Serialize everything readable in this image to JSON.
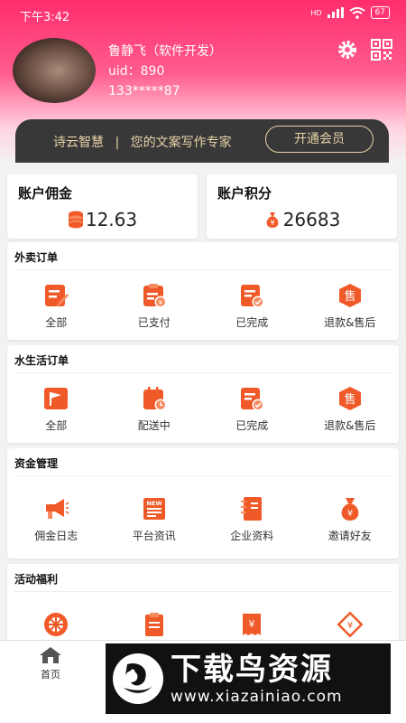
{
  "status": {
    "time": "下午3:42",
    "battery": "67",
    "net": "HD"
  },
  "user": {
    "name": "鲁静飞（软件开发）",
    "uid": "uid：890",
    "phone": "133*****87"
  },
  "member": {
    "brand": "诗云智慧",
    "divider": "|",
    "tagline": "您的文案写作专家",
    "button": "开通会员"
  },
  "accounts": [
    {
      "title": "账户佣金",
      "value": "12.63"
    },
    {
      "title": "账户积分",
      "value": "26683"
    }
  ],
  "sections": [
    {
      "title": "外卖订单",
      "items": [
        "全部",
        "已支付",
        "已完成",
        "退款&售后"
      ]
    },
    {
      "title": "水生活订单",
      "items": [
        "全部",
        "配送中",
        "已完成",
        "退款&售后"
      ]
    },
    {
      "title": "资金管理",
      "items": [
        "佣金日志",
        "平台资讯",
        "企业资料",
        "邀请好友"
      ]
    },
    {
      "title": "活动福利",
      "items": [
        "",
        "",
        "",
        ""
      ]
    }
  ],
  "tabbar": {
    "home": "首页"
  },
  "watermark": {
    "title": "下载鸟资源",
    "url": "www.xiazainiao.com"
  },
  "colors": {
    "accent": "#f05a28",
    "header": "#ff2d6c",
    "member_bg": "#383838",
    "member_text": "#e8d3a8"
  }
}
